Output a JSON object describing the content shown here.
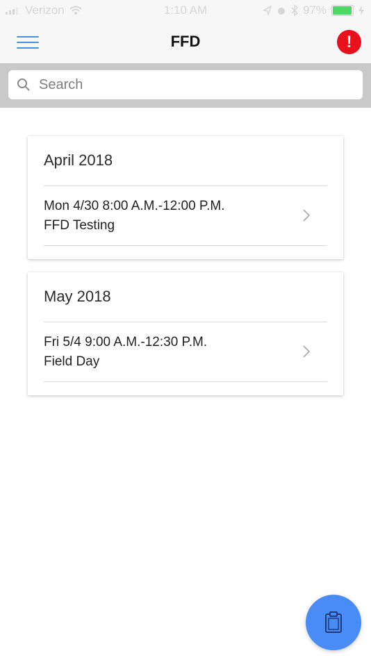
{
  "status_bar": {
    "carrier": "Verizon",
    "time": "1:10 AM",
    "battery": "97%",
    "battery_level": 0.97
  },
  "header": {
    "title": "FFD",
    "alert_symbol": "!"
  },
  "search": {
    "placeholder": "Search"
  },
  "sections": [
    {
      "month": "April 2018",
      "events": [
        {
          "time": "Mon 4/30 8:00 A.M.-12:00 P.M.",
          "name": "FFD Testing"
        }
      ]
    },
    {
      "month": "May 2018",
      "events": [
        {
          "time": "Fri 5/4 9:00 A.M.-12:30 P.M.",
          "name": "Field Day"
        }
      ]
    }
  ],
  "icons": {
    "menu": "hamburger-menu-icon",
    "alert": "alert-icon",
    "search": "search-icon",
    "chevron": "chevron-right-icon",
    "fab": "clipboard-icon"
  },
  "colors": {
    "accent": "#4a90e2",
    "alert": "#e8101a",
    "fab": "#4a8cf7"
  }
}
